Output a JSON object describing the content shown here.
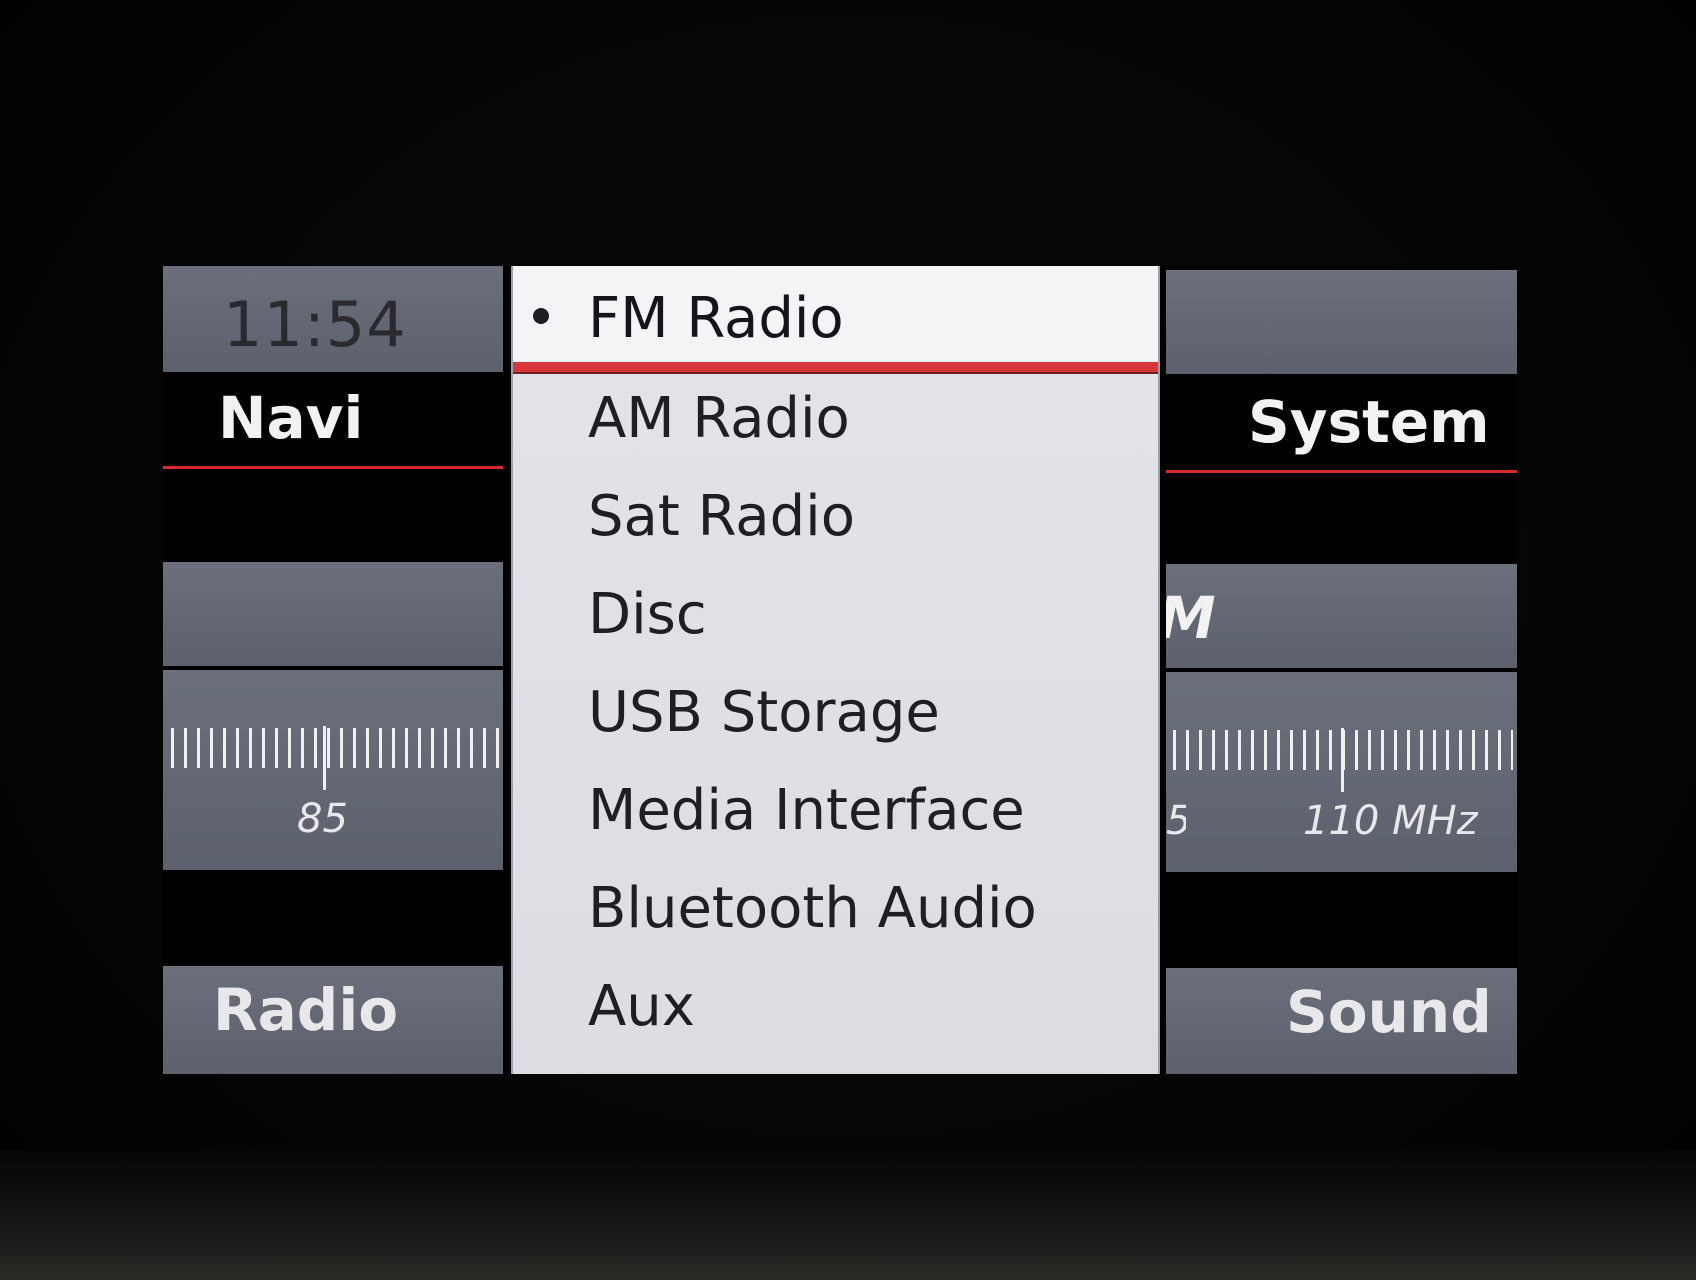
{
  "status": {
    "clock": "11:54"
  },
  "main_menu": {
    "top_left": "Navi",
    "top_right": "System",
    "bottom_left": "Radio",
    "bottom_right": "Sound"
  },
  "tuner": {
    "band_partial": "M",
    "scale_labels": [
      "85",
      "5",
      "110 MHz"
    ]
  },
  "source_dropdown": {
    "selected_index": 0,
    "items": [
      "FM Radio",
      "AM Radio",
      "Sat Radio",
      "Disc",
      "USB Storage",
      "Media Interface",
      "Bluetooth Audio",
      "Aux"
    ]
  },
  "colors": {
    "accent_red": "#d62a2a",
    "bar_gray": "#62666f",
    "dropdown_bg": "#e0e1e6"
  },
  "icons": {
    "selected_marker": "bullet-icon"
  }
}
